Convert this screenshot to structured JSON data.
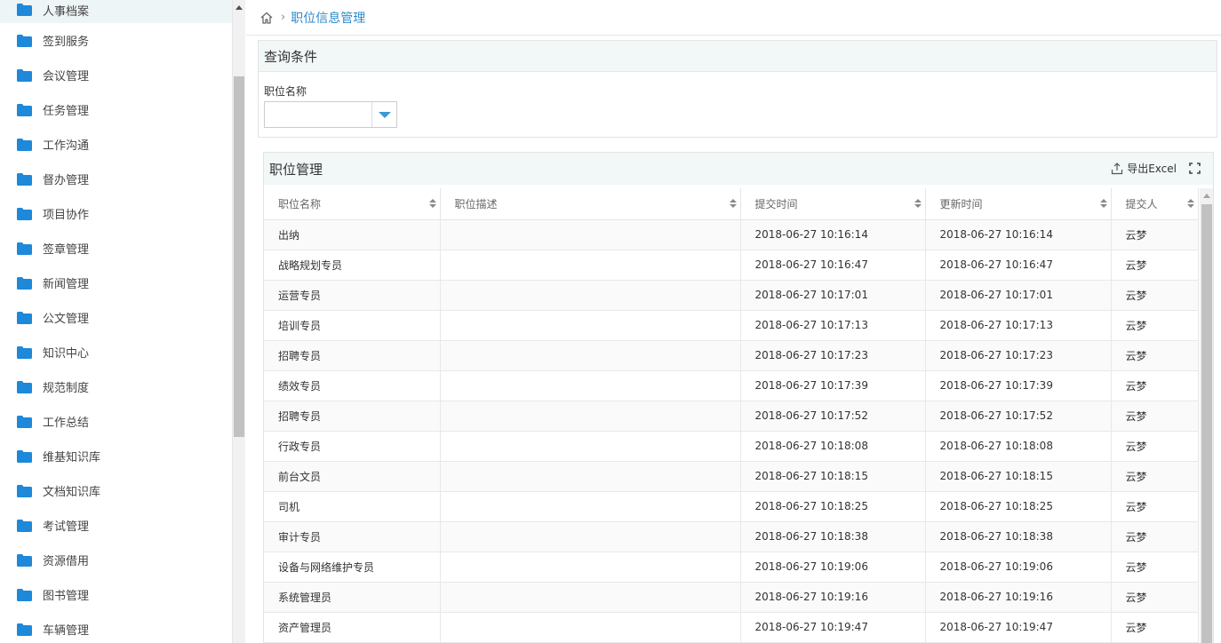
{
  "sidebar": {
    "items": [
      {
        "label": "人事档案",
        "active": true
      },
      {
        "label": "签到服务"
      },
      {
        "label": "会议管理"
      },
      {
        "label": "任务管理"
      },
      {
        "label": "工作沟通"
      },
      {
        "label": "督办管理"
      },
      {
        "label": "项目协作"
      },
      {
        "label": "签章管理"
      },
      {
        "label": "新闻管理"
      },
      {
        "label": "公文管理"
      },
      {
        "label": "知识中心"
      },
      {
        "label": "规范制度"
      },
      {
        "label": "工作总结"
      },
      {
        "label": "维基知识库"
      },
      {
        "label": "文档知识库"
      },
      {
        "label": "考试管理"
      },
      {
        "label": "资源借用"
      },
      {
        "label": "图书管理"
      },
      {
        "label": "车辆管理"
      }
    ],
    "icon": "folder-icon",
    "icon_color": "#1e88d9"
  },
  "breadcrumb": {
    "icon": "home-icon",
    "current": "职位信息管理"
  },
  "query": {
    "title": "查询条件",
    "field_label": "职位名称",
    "field_value": ""
  },
  "grid": {
    "title": "职位管理",
    "export_label": "导出Excel",
    "columns": [
      "职位名称",
      "职位描述",
      "提交时间",
      "更新时间",
      "提交人"
    ],
    "rows": [
      [
        "出纳",
        "",
        "2018-06-27 10:16:14",
        "2018-06-27 10:16:14",
        "云梦"
      ],
      [
        "战略规划专员",
        "",
        "2018-06-27 10:16:47",
        "2018-06-27 10:16:47",
        "云梦"
      ],
      [
        "运营专员",
        "",
        "2018-06-27 10:17:01",
        "2018-06-27 10:17:01",
        "云梦"
      ],
      [
        "培训专员",
        "",
        "2018-06-27 10:17:13",
        "2018-06-27 10:17:13",
        "云梦"
      ],
      [
        "招聘专员",
        "",
        "2018-06-27 10:17:23",
        "2018-06-27 10:17:23",
        "云梦"
      ],
      [
        "绩效专员",
        "",
        "2018-06-27 10:17:39",
        "2018-06-27 10:17:39",
        "云梦"
      ],
      [
        "招聘专员",
        "",
        "2018-06-27 10:17:52",
        "2018-06-27 10:17:52",
        "云梦"
      ],
      [
        "行政专员",
        "",
        "2018-06-27 10:18:08",
        "2018-06-27 10:18:08",
        "云梦"
      ],
      [
        "前台文员",
        "",
        "2018-06-27 10:18:15",
        "2018-06-27 10:18:15",
        "云梦"
      ],
      [
        "司机",
        "",
        "2018-06-27 10:18:25",
        "2018-06-27 10:18:25",
        "云梦"
      ],
      [
        "审计专员",
        "",
        "2018-06-27 10:18:38",
        "2018-06-27 10:18:38",
        "云梦"
      ],
      [
        "设备与网络维护专员",
        "",
        "2018-06-27 10:19:06",
        "2018-06-27 10:19:06",
        "云梦"
      ],
      [
        "系统管理员",
        "",
        "2018-06-27 10:19:16",
        "2018-06-27 10:19:16",
        "云梦"
      ],
      [
        "资产管理员",
        "",
        "2018-06-27 10:19:47",
        "2018-06-27 10:19:47",
        "云梦"
      ]
    ]
  },
  "colors": {
    "accent": "#2e8bcc",
    "panel_header_bg": "#f2f7f7"
  }
}
